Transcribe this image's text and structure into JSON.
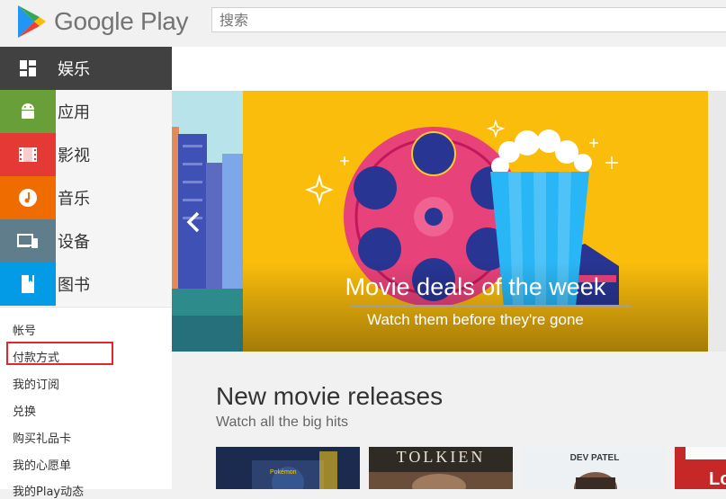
{
  "header": {
    "logo_text": "Google Play",
    "search_placeholder": "搜索"
  },
  "sidebar": {
    "items": [
      {
        "label": "娱乐",
        "icon": "entertainment-grid-icon",
        "active": true,
        "color": "#414141"
      },
      {
        "label": "应用",
        "icon": "android-icon",
        "color": "#689f38"
      },
      {
        "label": "影视",
        "icon": "film-icon",
        "color": "#e53935"
      },
      {
        "label": "音乐",
        "icon": "music-note-icon",
        "color": "#ef6c00"
      },
      {
        "label": "设备",
        "icon": "devices-icon",
        "color": "#607d8b"
      },
      {
        "label": "图书",
        "icon": "book-icon",
        "color": "#039be5"
      }
    ],
    "account_links": [
      "帐号",
      "付款方式",
      "我的订阅",
      "兑换",
      "购买礼品卡",
      "我的心愿单",
      "我的Play动态"
    ]
  },
  "banner": {
    "title": "Movie deals of the week",
    "subtitle": "Watch them before they're gone"
  },
  "section": {
    "title": "New movie releases",
    "subtitle": "Watch all the big hits"
  },
  "cards": [
    {
      "name": "pokemon-detective-pikachu-poster",
      "text": "Pokémon"
    },
    {
      "name": "tolkien-poster",
      "text": "TOLKIEN"
    },
    {
      "name": "dev-patel-poster",
      "text": "DEV PATEL"
    },
    {
      "name": "partial-poster",
      "text": "Lo"
    }
  ],
  "colors": {
    "banner_yellow": "#fbbd0c",
    "reel_pink": "#e8427a",
    "reel_navy": "#283593",
    "highlight_red": "#e3262b"
  }
}
